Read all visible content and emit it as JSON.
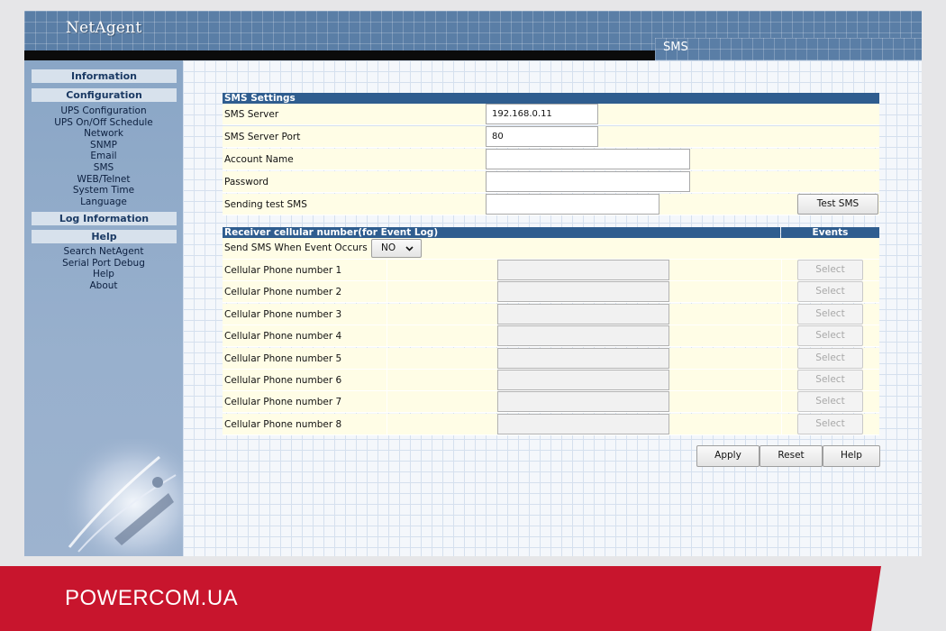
{
  "header": {
    "brand": "NetAgent",
    "page_title": "SMS"
  },
  "sidebar": {
    "information": "Information",
    "configuration": "Configuration",
    "config_items": [
      "UPS Configuration",
      "UPS On/Off Schedule",
      "Network",
      "SNMP",
      "Email",
      "SMS",
      "WEB/Telnet",
      "System Time",
      "Language"
    ],
    "log_information": "Log Information",
    "help": "Help",
    "help_items": [
      "Search NetAgent",
      "Serial Port Debug",
      "Help",
      "About"
    ]
  },
  "sms_settings": {
    "title": "SMS Settings",
    "server_label": "SMS Server",
    "server_value": "192.168.0.11",
    "port_label": "SMS Server Port",
    "port_value": "80",
    "account_label": "Account Name",
    "account_value": "",
    "password_label": "Password",
    "password_value": "",
    "test_label": "Sending test SMS",
    "test_value": "",
    "test_button": "Test SMS"
  },
  "receiver": {
    "title": "Receiver cellular number(for Event Log)",
    "events_header": "Events",
    "send_when_label": "Send SMS When Event Occurs",
    "send_when_value": "NO",
    "phone_labels": [
      "Cellular Phone number 1",
      "Cellular Phone number 2",
      "Cellular Phone number 3",
      "Cellular Phone number 4",
      "Cellular Phone number 5",
      "Cellular Phone number 6",
      "Cellular Phone number 7",
      "Cellular Phone number 8"
    ],
    "select_label": "Select"
  },
  "actions": {
    "apply": "Apply",
    "reset": "Reset",
    "help": "Help"
  },
  "footer": {
    "brand": "POWERCOM.UA"
  },
  "colors": {
    "section_bar": "#2f5d8f",
    "row_bg": "#fffde6",
    "footer_red": "#c8152d"
  }
}
